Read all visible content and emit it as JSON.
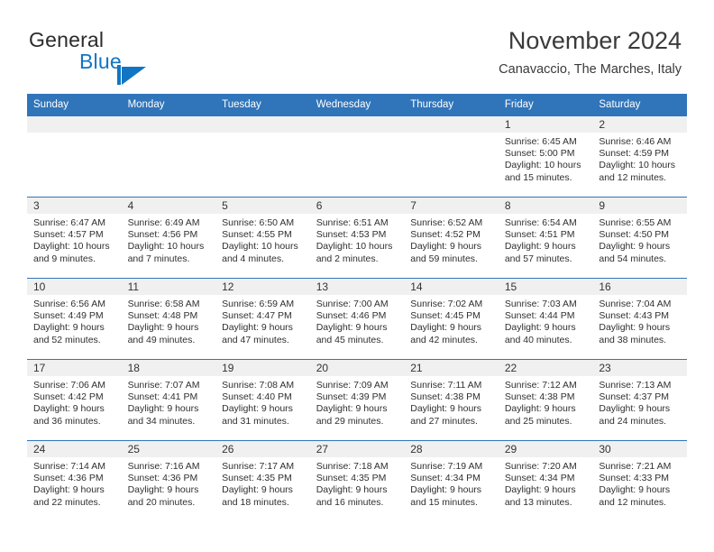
{
  "brand": {
    "word_one": "General",
    "word_two": "Blue",
    "mark": "triangle-flag-logo"
  },
  "header": {
    "month_title": "November 2024",
    "location": "Canavaccio, The Marches, Italy"
  },
  "colors": {
    "header_blue": "#3075ba",
    "brand_blue": "#1175c4",
    "daynum_band": "#f0f0f0",
    "text": "#333333"
  },
  "weekday_headers": [
    "Sunday",
    "Monday",
    "Tuesday",
    "Wednesday",
    "Thursday",
    "Friday",
    "Saturday"
  ],
  "weeks": [
    [
      {
        "empty": true
      },
      {
        "empty": true
      },
      {
        "empty": true
      },
      {
        "empty": true
      },
      {
        "empty": true
      },
      {
        "day": "1",
        "sunrise": "Sunrise: 6:45 AM",
        "sunset": "Sunset: 5:00 PM",
        "daylight": "Daylight: 10 hours and 15 minutes."
      },
      {
        "day": "2",
        "sunrise": "Sunrise: 6:46 AM",
        "sunset": "Sunset: 4:59 PM",
        "daylight": "Daylight: 10 hours and 12 minutes."
      }
    ],
    [
      {
        "day": "3",
        "sunrise": "Sunrise: 6:47 AM",
        "sunset": "Sunset: 4:57 PM",
        "daylight": "Daylight: 10 hours and 9 minutes."
      },
      {
        "day": "4",
        "sunrise": "Sunrise: 6:49 AM",
        "sunset": "Sunset: 4:56 PM",
        "daylight": "Daylight: 10 hours and 7 minutes."
      },
      {
        "day": "5",
        "sunrise": "Sunrise: 6:50 AM",
        "sunset": "Sunset: 4:55 PM",
        "daylight": "Daylight: 10 hours and 4 minutes."
      },
      {
        "day": "6",
        "sunrise": "Sunrise: 6:51 AM",
        "sunset": "Sunset: 4:53 PM",
        "daylight": "Daylight: 10 hours and 2 minutes."
      },
      {
        "day": "7",
        "sunrise": "Sunrise: 6:52 AM",
        "sunset": "Sunset: 4:52 PM",
        "daylight": "Daylight: 9 hours and 59 minutes."
      },
      {
        "day": "8",
        "sunrise": "Sunrise: 6:54 AM",
        "sunset": "Sunset: 4:51 PM",
        "daylight": "Daylight: 9 hours and 57 minutes."
      },
      {
        "day": "9",
        "sunrise": "Sunrise: 6:55 AM",
        "sunset": "Sunset: 4:50 PM",
        "daylight": "Daylight: 9 hours and 54 minutes."
      }
    ],
    [
      {
        "day": "10",
        "sunrise": "Sunrise: 6:56 AM",
        "sunset": "Sunset: 4:49 PM",
        "daylight": "Daylight: 9 hours and 52 minutes."
      },
      {
        "day": "11",
        "sunrise": "Sunrise: 6:58 AM",
        "sunset": "Sunset: 4:48 PM",
        "daylight": "Daylight: 9 hours and 49 minutes."
      },
      {
        "day": "12",
        "sunrise": "Sunrise: 6:59 AM",
        "sunset": "Sunset: 4:47 PM",
        "daylight": "Daylight: 9 hours and 47 minutes."
      },
      {
        "day": "13",
        "sunrise": "Sunrise: 7:00 AM",
        "sunset": "Sunset: 4:46 PM",
        "daylight": "Daylight: 9 hours and 45 minutes."
      },
      {
        "day": "14",
        "sunrise": "Sunrise: 7:02 AM",
        "sunset": "Sunset: 4:45 PM",
        "daylight": "Daylight: 9 hours and 42 minutes."
      },
      {
        "day": "15",
        "sunrise": "Sunrise: 7:03 AM",
        "sunset": "Sunset: 4:44 PM",
        "daylight": "Daylight: 9 hours and 40 minutes."
      },
      {
        "day": "16",
        "sunrise": "Sunrise: 7:04 AM",
        "sunset": "Sunset: 4:43 PM",
        "daylight": "Daylight: 9 hours and 38 minutes."
      }
    ],
    [
      {
        "day": "17",
        "sunrise": "Sunrise: 7:06 AM",
        "sunset": "Sunset: 4:42 PM",
        "daylight": "Daylight: 9 hours and 36 minutes."
      },
      {
        "day": "18",
        "sunrise": "Sunrise: 7:07 AM",
        "sunset": "Sunset: 4:41 PM",
        "daylight": "Daylight: 9 hours and 34 minutes."
      },
      {
        "day": "19",
        "sunrise": "Sunrise: 7:08 AM",
        "sunset": "Sunset: 4:40 PM",
        "daylight": "Daylight: 9 hours and 31 minutes."
      },
      {
        "day": "20",
        "sunrise": "Sunrise: 7:09 AM",
        "sunset": "Sunset: 4:39 PM",
        "daylight": "Daylight: 9 hours and 29 minutes."
      },
      {
        "day": "21",
        "sunrise": "Sunrise: 7:11 AM",
        "sunset": "Sunset: 4:38 PM",
        "daylight": "Daylight: 9 hours and 27 minutes."
      },
      {
        "day": "22",
        "sunrise": "Sunrise: 7:12 AM",
        "sunset": "Sunset: 4:38 PM",
        "daylight": "Daylight: 9 hours and 25 minutes."
      },
      {
        "day": "23",
        "sunrise": "Sunrise: 7:13 AM",
        "sunset": "Sunset: 4:37 PM",
        "daylight": "Daylight: 9 hours and 24 minutes."
      }
    ],
    [
      {
        "day": "24",
        "sunrise": "Sunrise: 7:14 AM",
        "sunset": "Sunset: 4:36 PM",
        "daylight": "Daylight: 9 hours and 22 minutes."
      },
      {
        "day": "25",
        "sunrise": "Sunrise: 7:16 AM",
        "sunset": "Sunset: 4:36 PM",
        "daylight": "Daylight: 9 hours and 20 minutes."
      },
      {
        "day": "26",
        "sunrise": "Sunrise: 7:17 AM",
        "sunset": "Sunset: 4:35 PM",
        "daylight": "Daylight: 9 hours and 18 minutes."
      },
      {
        "day": "27",
        "sunrise": "Sunrise: 7:18 AM",
        "sunset": "Sunset: 4:35 PM",
        "daylight": "Daylight: 9 hours and 16 minutes."
      },
      {
        "day": "28",
        "sunrise": "Sunrise: 7:19 AM",
        "sunset": "Sunset: 4:34 PM",
        "daylight": "Daylight: 9 hours and 15 minutes."
      },
      {
        "day": "29",
        "sunrise": "Sunrise: 7:20 AM",
        "sunset": "Sunset: 4:34 PM",
        "daylight": "Daylight: 9 hours and 13 minutes."
      },
      {
        "day": "30",
        "sunrise": "Sunrise: 7:21 AM",
        "sunset": "Sunset: 4:33 PM",
        "daylight": "Daylight: 9 hours and 12 minutes."
      }
    ]
  ]
}
